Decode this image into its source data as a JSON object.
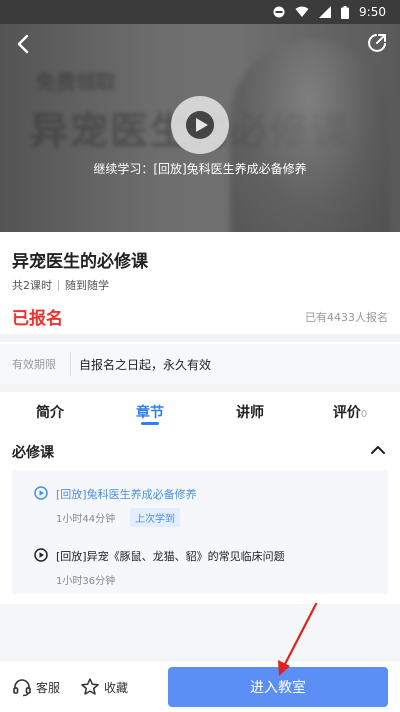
{
  "status_bar": {
    "time": "9:50"
  },
  "video": {
    "continue_text": "继续学习：[回放]兔科医生养成必备修养",
    "blurred_caption_1": "免费领取",
    "blurred_caption_2": "异宠医生的必修课"
  },
  "course": {
    "title": "异宠医生的必修课",
    "lesson_count": "共2课时",
    "mode": "随到随学",
    "status": "已报名",
    "enrolled_count": "已有4433人报名"
  },
  "validity": {
    "label": "有效期限",
    "value": "自报名之日起，永久有效"
  },
  "tabs": [
    {
      "label": "简介"
    },
    {
      "label": "章节"
    },
    {
      "label": "讲师"
    },
    {
      "label": "评价",
      "count": "0"
    }
  ],
  "section": {
    "title": "必修课"
  },
  "lessons": [
    {
      "name": "[回放]兔科医生养成必备修养",
      "duration": "1小时44分钟",
      "badge": "上次学到"
    },
    {
      "name": "[回放]异宠《豚鼠、龙猫、貂》的常见临床问题",
      "duration": "1小时36分钟"
    }
  ],
  "bottom": {
    "customer_service": "客服",
    "favorite": "收藏",
    "enter_button": "进入教室"
  },
  "colors": {
    "accent": "#2f80ed",
    "button": "#5b8ff5",
    "enrolled": "#f0322f"
  }
}
